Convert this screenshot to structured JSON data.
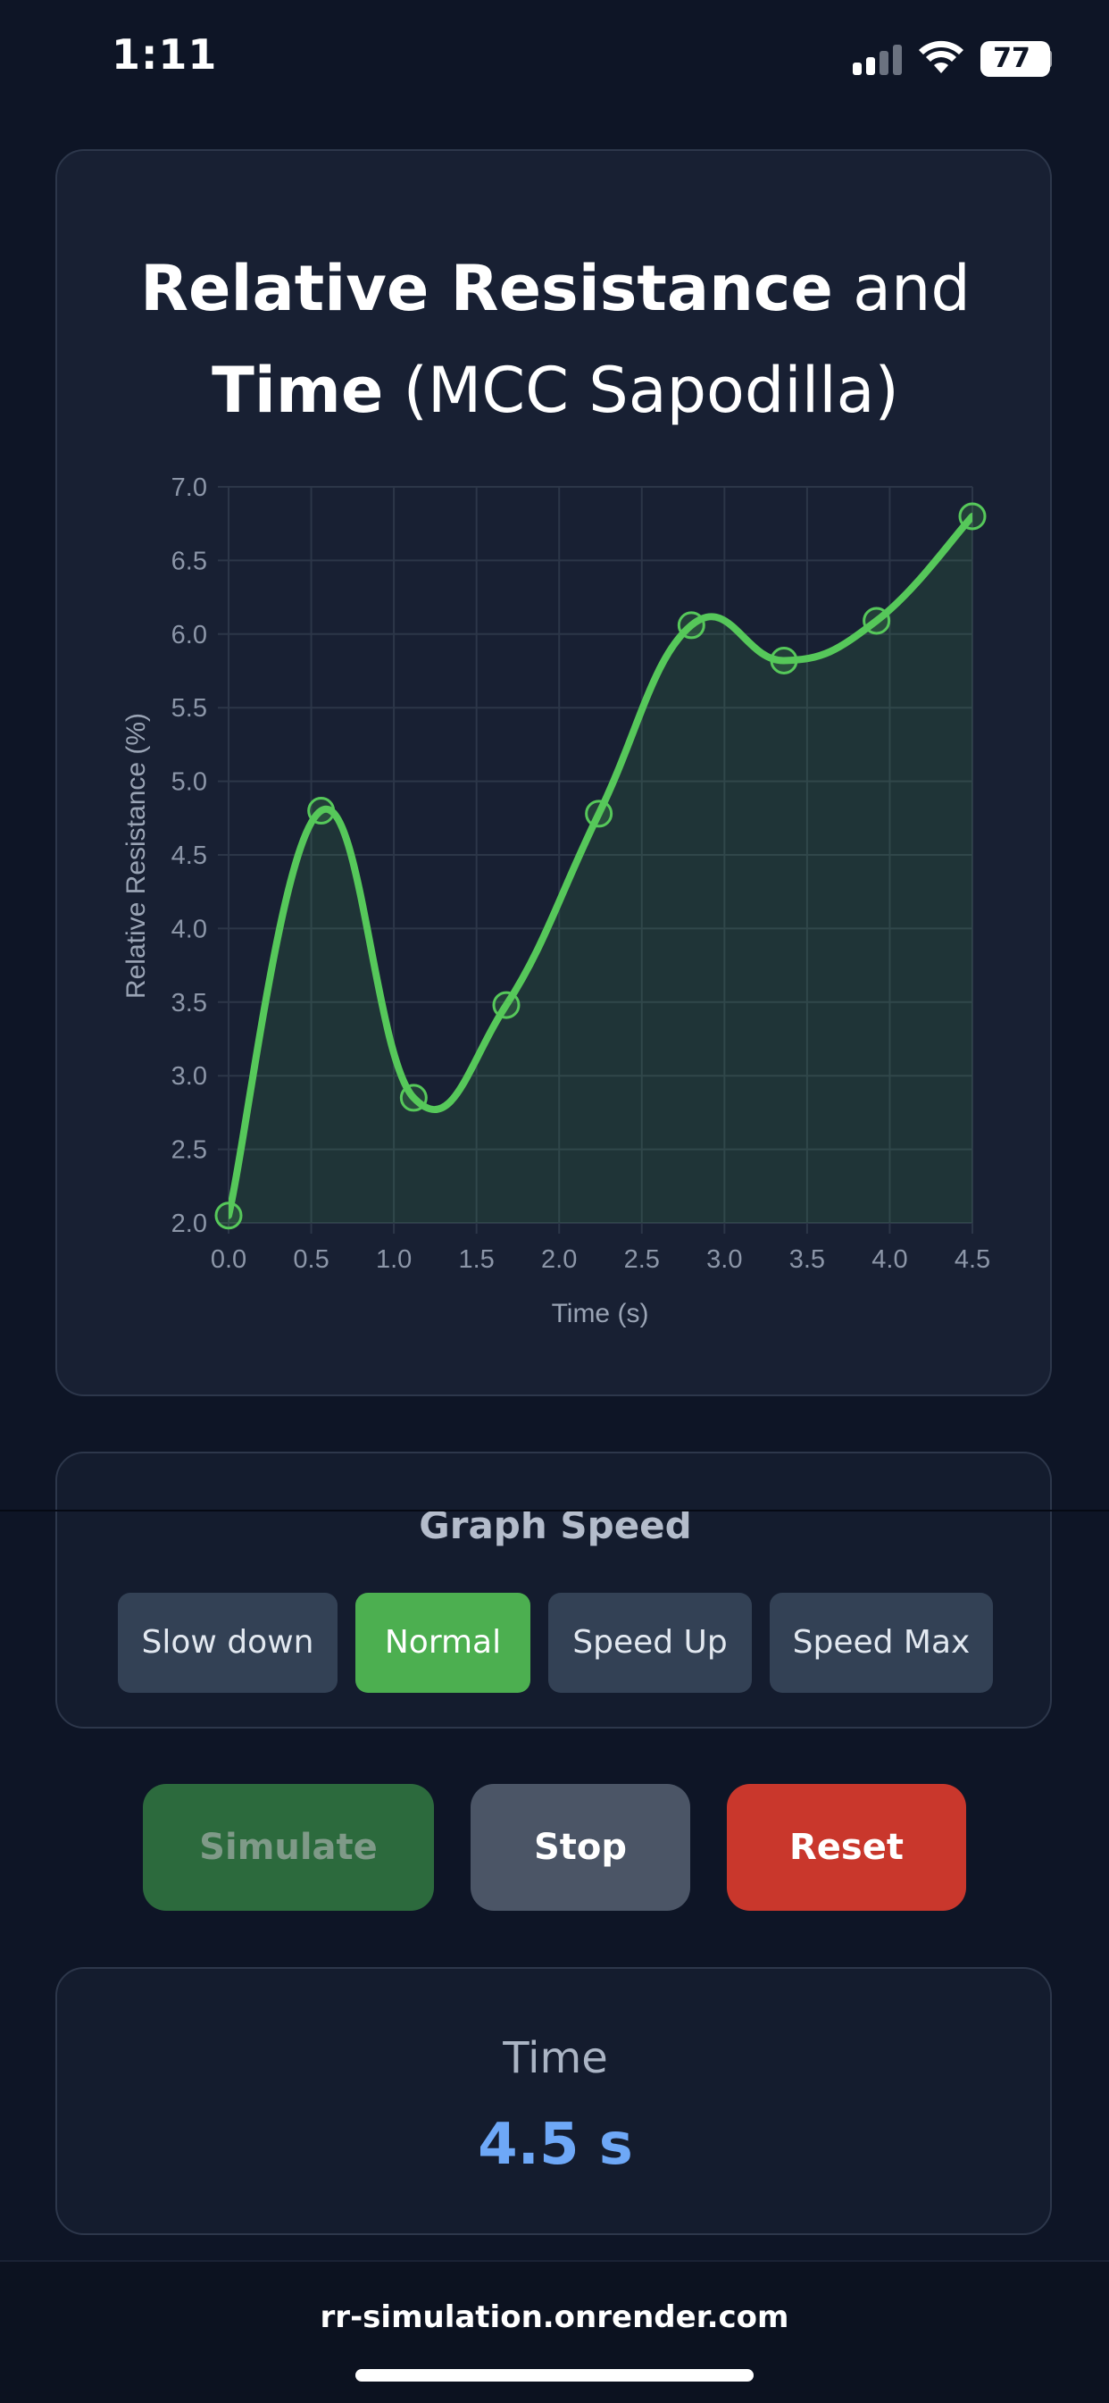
{
  "status": {
    "time": "1:11",
    "battery": "77"
  },
  "chart_card": {
    "title_line1_bold": "Relative Resistance",
    "title_line1_rest": " and",
    "title_line2_bold": "Time",
    "title_line2_rest": " (MCC Sapodilla)"
  },
  "chart_data": {
    "type": "line",
    "title": "Relative Resistance and Time (MCC Sapodilla)",
    "xlabel": "Time (s)",
    "ylabel": "Relative Resistance (%)",
    "xlim": [
      0,
      4.5
    ],
    "ylim": [
      2.0,
      7.0
    ],
    "xticks": [
      "0.0",
      "0.5",
      "1.0",
      "1.5",
      "2.0",
      "2.5",
      "3.0",
      "3.5",
      "4.0",
      "4.5"
    ],
    "yticks": [
      "2.0",
      "2.5",
      "3.0",
      "3.5",
      "4.0",
      "4.5",
      "5.0",
      "5.5",
      "6.0",
      "6.5",
      "7.0"
    ],
    "grid": true,
    "series": [
      {
        "color": "#56c85a",
        "fill": true,
        "x": [
          0.0,
          0.56,
          1.12,
          1.68,
          2.24,
          2.8,
          3.36,
          3.92,
          4.5
        ],
        "y": [
          2.05,
          4.8,
          2.85,
          3.48,
          4.78,
          6.06,
          5.82,
          6.09,
          6.8
        ]
      }
    ]
  },
  "speed": {
    "title": "Graph Speed",
    "buttons": [
      {
        "label": "Slow down"
      },
      {
        "label": "Normal"
      },
      {
        "label": "Speed Up"
      },
      {
        "label": "Speed Max"
      }
    ]
  },
  "actions": {
    "simulate": "Simulate",
    "stop": "Stop",
    "reset": "Reset"
  },
  "time_display": {
    "label": "Time",
    "value": "4.5 s"
  },
  "browser": {
    "url": "rr-simulation.onrender.com"
  }
}
